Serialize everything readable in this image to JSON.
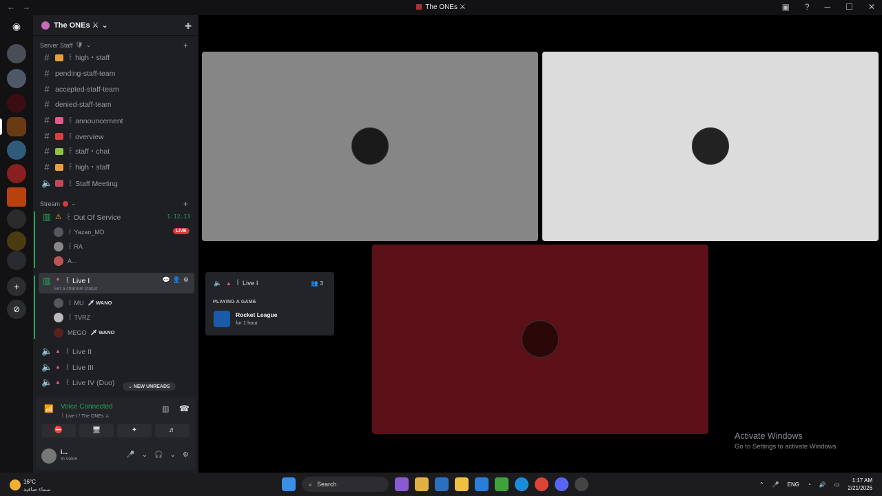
{
  "window": {
    "title": "The ONEs ⚔",
    "nav_back": "←",
    "nav_forward": "→",
    "icons": [
      "inbox-icon",
      "help-icon",
      "minimize-icon",
      "maximize-icon",
      "close-icon"
    ],
    "help_glyph": "?",
    "inbox_glyph": "▣",
    "min_glyph": "─",
    "max_glyph": "☐",
    "close_glyph": "✕"
  },
  "server": {
    "name": "The ONEs ⚔",
    "chevron": "⌄",
    "invite_glyph": "✚"
  },
  "categories": [
    {
      "name": "Server Staff",
      "icon": "🛡",
      "chevron": "⌄",
      "plus": "+"
    },
    {
      "name": "Stream",
      "icon": "🔴",
      "chevron": "⌄",
      "plus": "+"
    }
  ],
  "staff_channels": [
    {
      "type": "text",
      "label": "꒰ high・staff",
      "emoji_color": "#e8a03a"
    },
    {
      "type": "text",
      "label": "pending-staff-team",
      "emoji_color": ""
    },
    {
      "type": "text",
      "label": "accepted-staff-team",
      "emoji_color": ""
    },
    {
      "type": "text",
      "label": "denied-staff-team",
      "emoji_color": ""
    },
    {
      "type": "text",
      "label": "꒰ announcement",
      "emoji_color": "#e05a8a"
    },
    {
      "type": "text",
      "label": "꒰ overview",
      "emoji_color": "#d84040"
    },
    {
      "type": "text",
      "label": "꒰ staff・chat",
      "emoji_color": "#8bc34a"
    },
    {
      "type": "text",
      "label": "꒰ high・staff",
      "emoji_color": "#e8a03a"
    },
    {
      "type": "voice",
      "label": "꒰ Staff Meeting",
      "emoji_color": "#c0485a"
    }
  ],
  "stream_channels": {
    "out_of_service": {
      "label": "꒰ Out Of Service",
      "timer": "1:12:13",
      "emoji": "⚠"
    },
    "out_users": [
      {
        "name": "꒰ Yazan_MD",
        "live": "LIVE"
      },
      {
        "name": "꒰ RA"
      },
      {
        "name": "A..."
      }
    ],
    "live1": {
      "label": "꒰ Live I",
      "status": "Set a channel status",
      "actions": [
        "💬",
        "👤",
        "⚙"
      ]
    },
    "live1_users": [
      {
        "name": "꒰ MU",
        "tag": "🗡 WANO"
      },
      {
        "name": "꒰ TVRZ",
        "tag": ""
      },
      {
        "name": "MEGO",
        "tag": "🗡 WANO"
      }
    ],
    "others": [
      "꒰ Live II",
      "꒰ Live III",
      "꒰ Live IV (Duo)"
    ]
  },
  "unread_pill": "⌄ NEW UNREADS",
  "voice_panel": {
    "title": "Voice Connected",
    "subtitle": "꒰ Live I / The ONEs ⚔",
    "signal_glyph": "📶",
    "buttons": [
      "⛔",
      "🖥",
      "✦",
      "♬"
    ],
    "wave_glyph": "▥",
    "hangup_glyph": "☎"
  },
  "user": {
    "name": "i...",
    "status": "In voice",
    "controls": [
      "🎤",
      "⌄",
      "🎧",
      "⌄",
      "⚙"
    ]
  },
  "activity_card": {
    "channel": "꒰ Live I",
    "count": "3",
    "count_glyph": "👥",
    "label": "PLAYING A GAME",
    "game": "Rocket League",
    "duration": "for 1 hour"
  },
  "watermark": {
    "line1": "Activate Windows",
    "line2": "Go to Settings to activate Windows."
  },
  "taskbar": {
    "temp": "16°C",
    "weather_desc": "سماء صافية",
    "search": "Search",
    "lang": "ENG",
    "time": "1:17 AM",
    "date": "2/21/2026"
  },
  "colors": {
    "tile1": "#868686",
    "tile2": "#dcdcdc",
    "tile3": "#5c1017",
    "accent_green": "#23a55a",
    "live_red": "#da373c"
  }
}
